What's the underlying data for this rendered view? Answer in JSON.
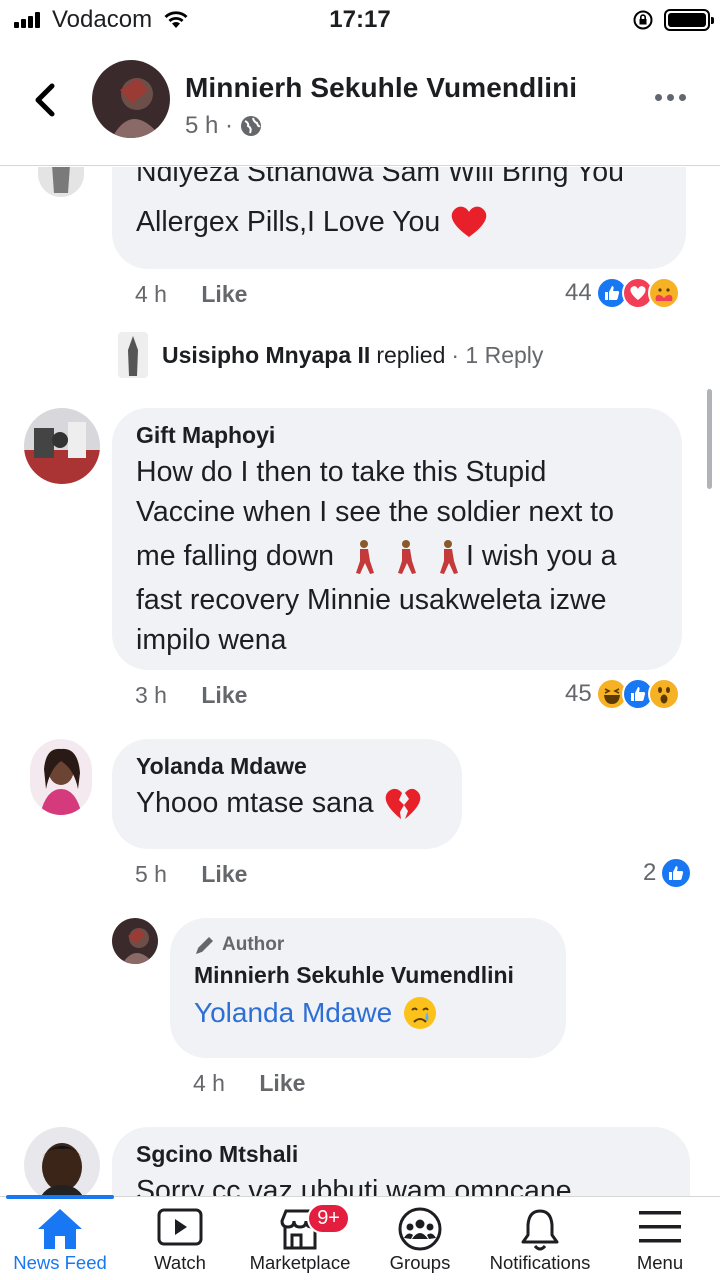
{
  "status_bar": {
    "carrier": "Vodacom",
    "time": "17:17"
  },
  "header": {
    "title": "Minnierh Sekuhle Vumendlini",
    "meta": "5 h ·"
  },
  "comments": {
    "first": {
      "text_line1": "Ndiyeza Sthandwa Sam Will Bring You",
      "text_line2": "Allergex Pills,I Love You",
      "time": "4 h",
      "like_label": "Like",
      "reactions": "44",
      "replied_name": "Usisipho Mnyapa II",
      "replied_word": "replied",
      "reply_count": "· 1 Reply"
    },
    "gift": {
      "name": "Gift Maphoyi",
      "line1": "How do I then to take this Stupid",
      "line2": "Vaccine when I see the soldier next to",
      "line3a": "me falling down",
      "line3b": "I wish you a",
      "line4": "fast recovery Minnie usakweleta izwe",
      "line5": "impilo wena",
      "time": "3 h",
      "like_label": "Like",
      "reactions": "45"
    },
    "yolanda": {
      "name": "Yolanda Mdawe",
      "text": "Yhooo mtase sana",
      "time": "5 h",
      "like_label": "Like",
      "reactions": "2"
    },
    "author_reply": {
      "tag": "Author",
      "name": "Minnierh Sekuhle Vumendlini",
      "mention": "Yolanda Mdawe",
      "time": "4 h",
      "like_label": "Like"
    },
    "sgcino": {
      "name": "Sgcino Mtshali",
      "text": "Sorry cc vaz ubbuti wam omncane"
    }
  },
  "bottom_nav": {
    "items": [
      {
        "label": "News Feed",
        "icon": "home-icon",
        "active": true
      },
      {
        "label": "Watch",
        "icon": "watch-icon"
      },
      {
        "label": "Marketplace",
        "icon": "marketplace-icon",
        "badge": "9+"
      },
      {
        "label": "Groups",
        "icon": "groups-icon"
      },
      {
        "label": "Notifications",
        "icon": "bell-icon"
      },
      {
        "label": "Menu",
        "icon": "menu-icon"
      }
    ]
  },
  "colors": {
    "accent": "#1877f2",
    "bubble": "#f0f2f5",
    "badge": "#e41e3f",
    "mention": "#2e6fd6"
  }
}
